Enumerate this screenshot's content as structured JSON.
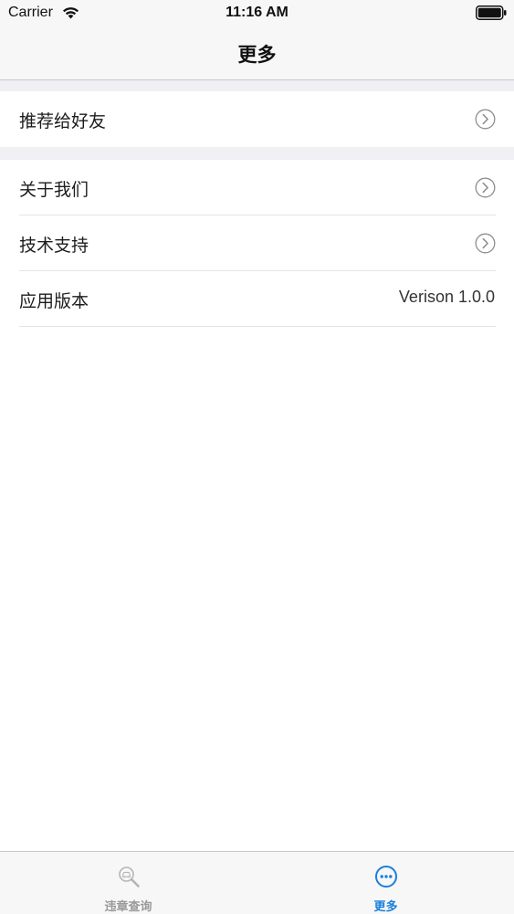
{
  "status_bar": {
    "carrier": "Carrier",
    "time": "11:16 AM"
  },
  "nav": {
    "title": "更多"
  },
  "sections": [
    {
      "rows": [
        {
          "label": "推荐给好友",
          "accessory": "chevron-icon"
        }
      ]
    },
    {
      "rows": [
        {
          "label": "关于我们",
          "accessory": "chevron-icon"
        },
        {
          "label": "技术支持",
          "accessory": "chevron-icon"
        },
        {
          "label": "应用版本",
          "value": "Verison 1.0.0"
        }
      ]
    }
  ],
  "tab_bar": {
    "tabs": [
      {
        "label": "违章查询",
        "icon": "search-car-icon",
        "selected": false
      },
      {
        "label": "更多",
        "icon": "more-icon",
        "selected": true
      }
    ]
  },
  "colors": {
    "bar_background": "#f7f7f7",
    "group_background": "#efeff4",
    "tab_active": "#1a7fdb",
    "tab_inactive": "#9a9a9a",
    "chevron": "#8e8e93"
  }
}
